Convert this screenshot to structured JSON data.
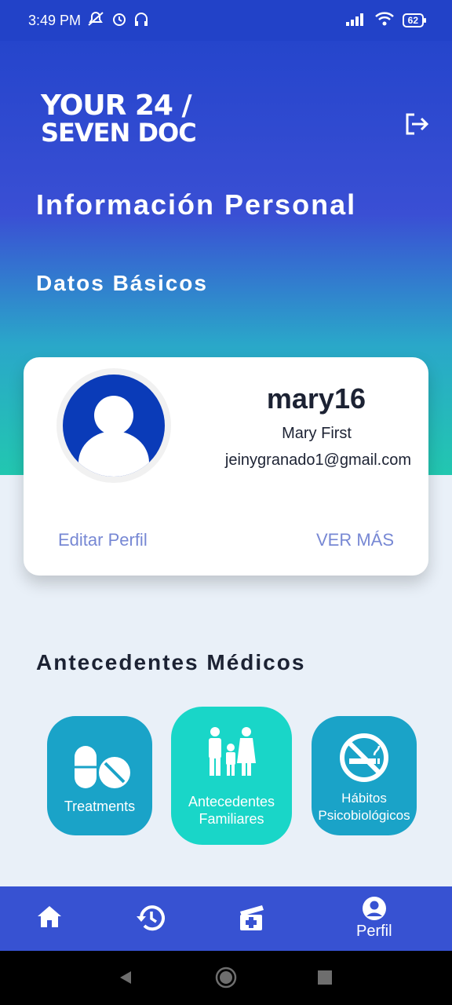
{
  "status": {
    "time": "3:49 PM",
    "battery": "62"
  },
  "logo": {
    "line1": "YOUR 24 /",
    "line2": "SEVEN DOC"
  },
  "header": {
    "title": "Información Personal",
    "section": "Datos Básicos"
  },
  "profile": {
    "username": "mary16",
    "full_name": "Mary First",
    "email": "jeinygranado1@gmail.com",
    "edit_label": "Editar Perfil",
    "more_label": "VER MÁS"
  },
  "medical": {
    "title": "Antecedentes Médicos",
    "tiles": [
      {
        "label": "Treatments",
        "icon": "pills-icon"
      },
      {
        "label_line1": "Antecedentes",
        "label_line2": "Familiares",
        "icon": "family-icon"
      },
      {
        "label_line1": "Hábitos",
        "label_line2": "Psicobiológicos",
        "icon": "no-smoking-icon"
      }
    ]
  },
  "nav": {
    "profile_label": "Perfil"
  },
  "colors": {
    "primary": "#3752d2",
    "teal": "#19d6c8",
    "tile": "#1aa3c8",
    "link": "#7788d4"
  }
}
